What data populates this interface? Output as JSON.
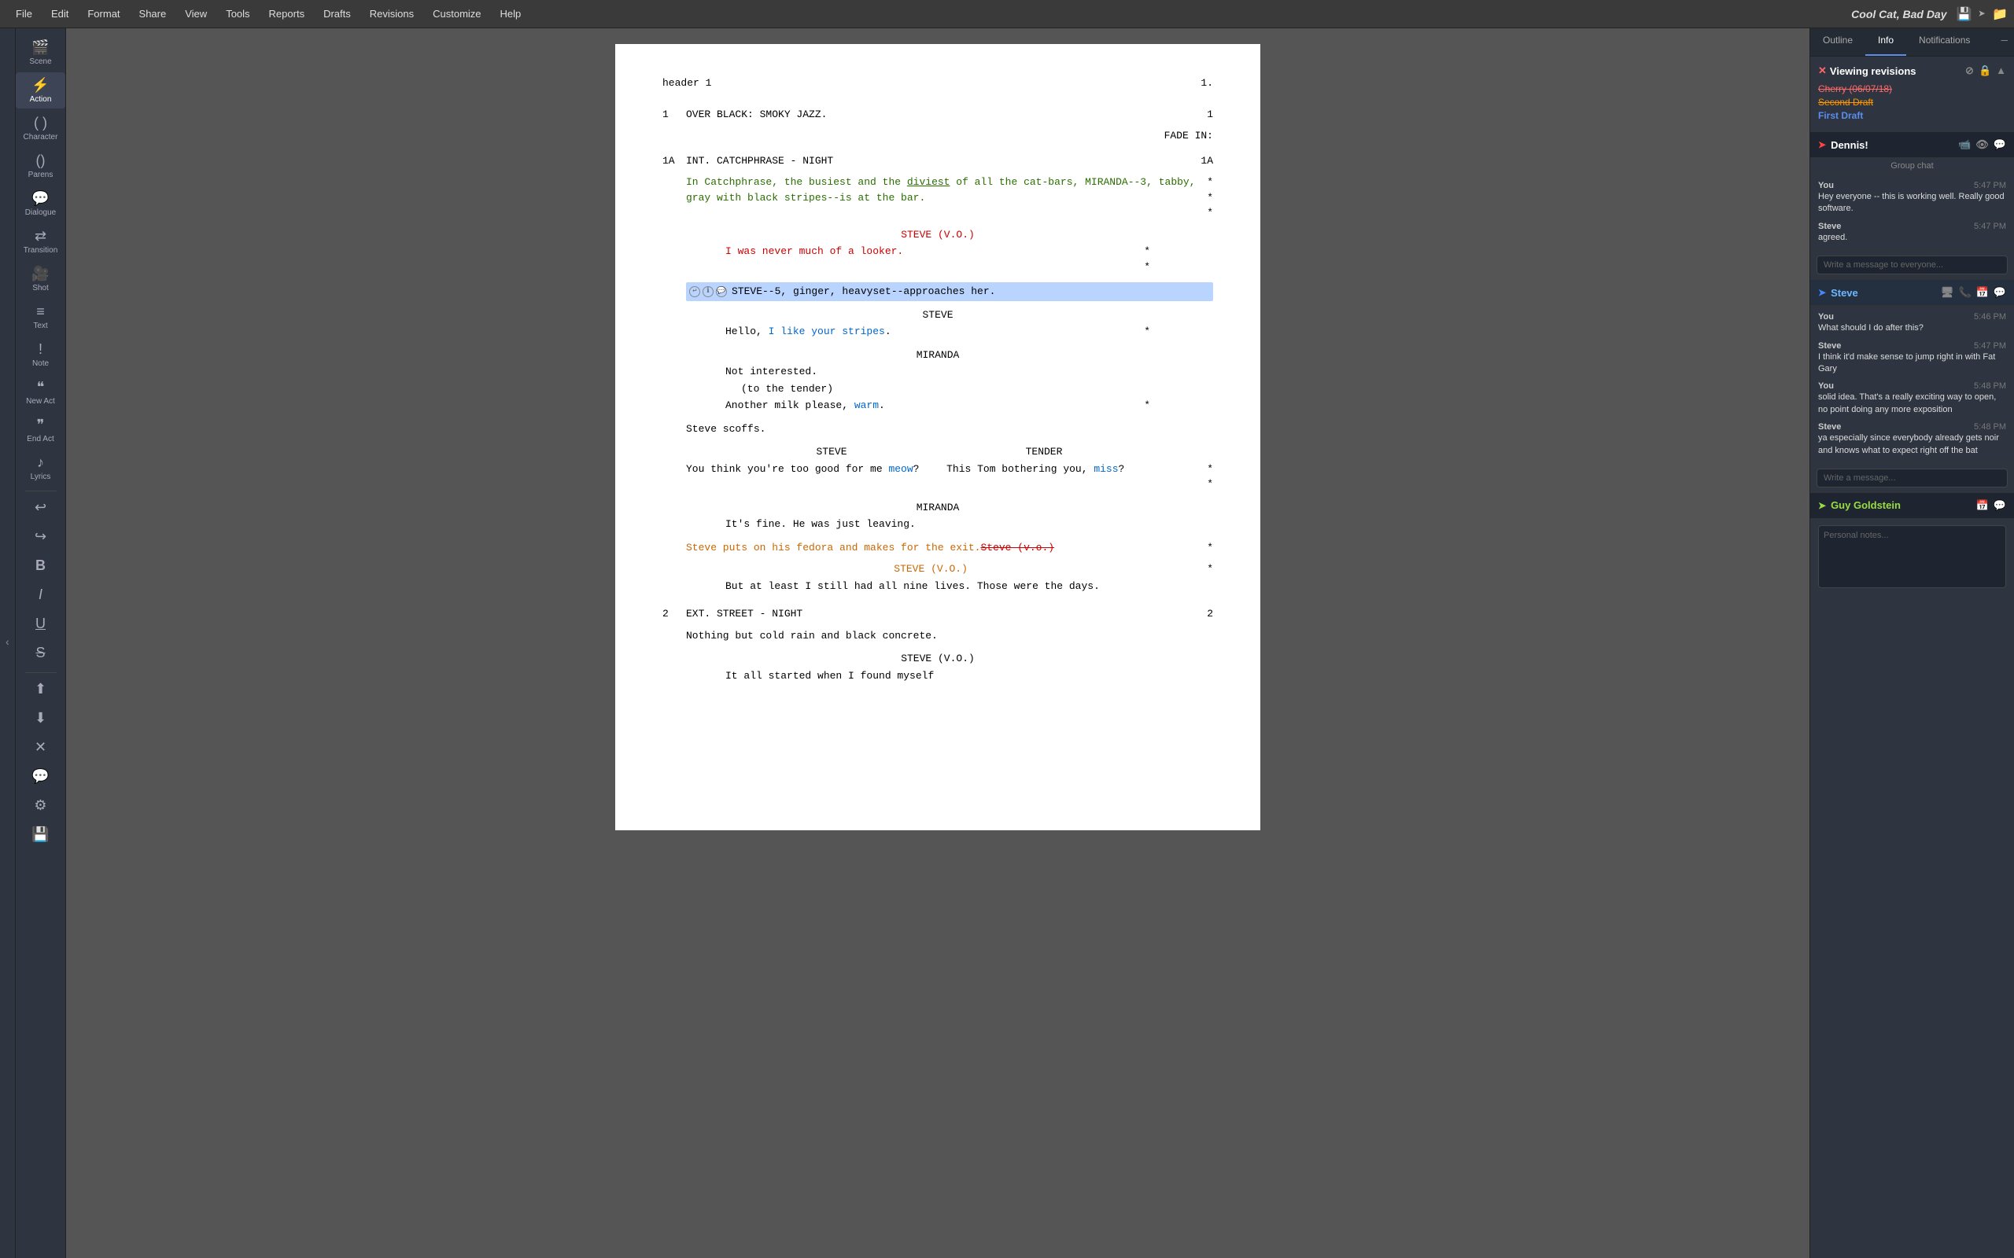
{
  "app": {
    "title": "Cool Cat, Bad Day",
    "menu_items": [
      "File",
      "Edit",
      "Format",
      "Share",
      "View",
      "Tools",
      "Reports",
      "Drafts",
      "Revisions",
      "Customize",
      "Help"
    ]
  },
  "sidebar": {
    "items": [
      {
        "id": "scene",
        "label": "Scene",
        "icon": "🎬",
        "active": false
      },
      {
        "id": "action",
        "label": "Action",
        "icon": "⚡",
        "active": true
      },
      {
        "id": "character",
        "label": "Character",
        "icon": "( )",
        "active": false
      },
      {
        "id": "parens",
        "label": "Parens",
        "icon": "()",
        "active": false
      },
      {
        "id": "dialogue",
        "label": "Dialogue",
        "icon": "💬",
        "active": false
      },
      {
        "id": "transition",
        "label": "Transition",
        "icon": "⇄",
        "active": false
      },
      {
        "id": "shot",
        "label": "Shot",
        "icon": "🎥",
        "active": false
      },
      {
        "id": "text",
        "label": "Text",
        "icon": "≡",
        "active": false
      },
      {
        "id": "note",
        "label": "Note",
        "icon": "!",
        "active": false
      },
      {
        "id": "new-act",
        "label": "New Act",
        "icon": "\"\"",
        "active": false
      },
      {
        "id": "end-act",
        "label": "End Act",
        "icon": "\"\"",
        "active": false
      },
      {
        "id": "lyrics",
        "label": "Lyrics",
        "icon": "♪",
        "active": false
      },
      {
        "id": "undo",
        "label": "Undo",
        "icon": "↩",
        "active": false
      },
      {
        "id": "redo",
        "label": "Redo",
        "icon": "↪",
        "active": false
      },
      {
        "id": "bold",
        "label": "Bold",
        "icon": "B",
        "active": false
      },
      {
        "id": "italic",
        "label": "Italic",
        "icon": "I",
        "active": false
      },
      {
        "id": "underline",
        "label": "Underline",
        "icon": "U̲",
        "active": false
      },
      {
        "id": "strikethrough",
        "label": "Strike",
        "icon": "S̶",
        "active": false
      },
      {
        "id": "upload",
        "label": "Upload",
        "icon": "⬆",
        "active": false
      },
      {
        "id": "download",
        "label": "Download",
        "icon": "⬇",
        "active": false
      },
      {
        "id": "x-btn",
        "label": "Remove",
        "icon": "✕",
        "active": false
      },
      {
        "id": "chat",
        "label": "Chat",
        "icon": "💬",
        "active": false
      },
      {
        "id": "settings",
        "label": "Settings",
        "icon": "⚙",
        "active": false
      },
      {
        "id": "save",
        "label": "Save",
        "icon": "💾",
        "active": false
      }
    ]
  },
  "script": {
    "header": "header 1",
    "page_num_header": "1.",
    "lines": [
      {
        "type": "scene-line-num",
        "num": "1",
        "text": "OVER BLACK: SMOKY JAZZ.",
        "page_num": "1"
      },
      {
        "type": "transition",
        "text": "FADE IN:"
      },
      {
        "type": "scene-heading",
        "num": "1A",
        "text": "INT. CATCHPHRASE - NIGHT",
        "page_num": "1A"
      },
      {
        "type": "action-added",
        "text": "In Catchphrase, the busiest and the diviest of all the cat-bars, MIRANDA--3, tabby, gray with black stripes--is at the bar.",
        "asterisk": "* * *"
      },
      {
        "type": "character",
        "text": "STEVE (V.O.)"
      },
      {
        "type": "dialogue-added",
        "text": "I was never much of a looker.",
        "asterisk": "* *"
      },
      {
        "type": "action-highlighted",
        "text": "STEVE--5, ginger, heavyset--approaches her."
      },
      {
        "type": "character",
        "text": "STEVE"
      },
      {
        "type": "dialogue",
        "text": "Hello, I like your stripes.",
        "inline_blue": "I like your stripes",
        "asterisk": "*"
      },
      {
        "type": "character",
        "text": "MIRANDA"
      },
      {
        "type": "dialogue",
        "text": "Not interested."
      },
      {
        "type": "parenthetical",
        "text": "(to the tender)"
      },
      {
        "type": "dialogue",
        "text": "Another milk please, warm.",
        "inline_blue": "warm",
        "asterisk": "*"
      },
      {
        "type": "action",
        "text": "Steve scoffs."
      },
      {
        "type": "dual-dialogue-chars",
        "left": "STEVE",
        "right": "TENDER"
      },
      {
        "type": "dual-dialogue",
        "left": "You think you're too good for me meow?",
        "right": "This Tom bothering you, miss?",
        "inline_blue_left": "meow",
        "inline_blue_right": "miss",
        "asterisk": "* *"
      },
      {
        "type": "character",
        "text": "MIRANDA"
      },
      {
        "type": "dialogue",
        "text": "It's fine. He was just leaving."
      },
      {
        "type": "action-changed",
        "text": "Steve puts on his fedora and makes for the exit.",
        "deleted": "Steve (v.o.)",
        "asterisk": "*"
      },
      {
        "type": "character-changed",
        "text": "STEVE (V.O.)",
        "asterisk": "*"
      },
      {
        "type": "dialogue",
        "text": "But at least I still had all nine lives. Those were the days."
      },
      {
        "type": "scene-heading",
        "num": "2",
        "text": "EXT. STREET - NIGHT",
        "page_num": "2"
      },
      {
        "type": "action",
        "text": "Nothing but cold rain and black concrete."
      },
      {
        "type": "character",
        "text": "STEVE (V.O.)"
      },
      {
        "type": "dialogue",
        "text": "It all started when I found myself"
      }
    ]
  },
  "right_panel": {
    "tabs": [
      "Outline",
      "Info",
      "Notifications"
    ],
    "active_tab": "Info",
    "revisions": {
      "title": "Viewing revisions",
      "items": [
        {
          "label": "Cherry (06/07/18)",
          "status": "current"
        },
        {
          "label": "Second Draft",
          "status": "compare"
        },
        {
          "label": "First Draft",
          "status": "selected"
        }
      ]
    },
    "chats": [
      {
        "user": "Dennis!",
        "color": "dennis",
        "icons": [
          "📹",
          "👁",
          "💬"
        ],
        "group_chat_label": "Group chat",
        "messages": [
          {
            "sender": "You",
            "time": "5:47 PM",
            "body": "Hey everyone -- this is working well. Really good software."
          },
          {
            "sender": "Steve",
            "time": "5:47 PM",
            "body": "agreed."
          }
        ],
        "input_placeholder": "Write a message to everyone..."
      },
      {
        "user": "Steve",
        "color": "steve",
        "icons": [
          "🖥",
          "📞",
          "📅",
          "💬"
        ],
        "messages": [
          {
            "sender": "You",
            "time": "5:46 PM",
            "body": "What should I do after this?"
          },
          {
            "sender": "Steve",
            "time": "5:47 PM",
            "body": "I think it'd make sense to jump right in with Fat Gary"
          },
          {
            "sender": "You",
            "time": "5:48 PM",
            "body": "solid idea. That's a really exciting way to open, no point doing any more exposition"
          },
          {
            "sender": "Steve",
            "time": "5:48 PM",
            "body": "ya especially since everybody already gets noir and knows what to expect right off the bat"
          }
        ],
        "input_placeholder": "Write a message..."
      },
      {
        "user": "Guy Goldstein",
        "color": "guy",
        "icons": [
          "📅",
          "💬"
        ]
      }
    ],
    "personal_notes_placeholder": "Personal notes..."
  }
}
